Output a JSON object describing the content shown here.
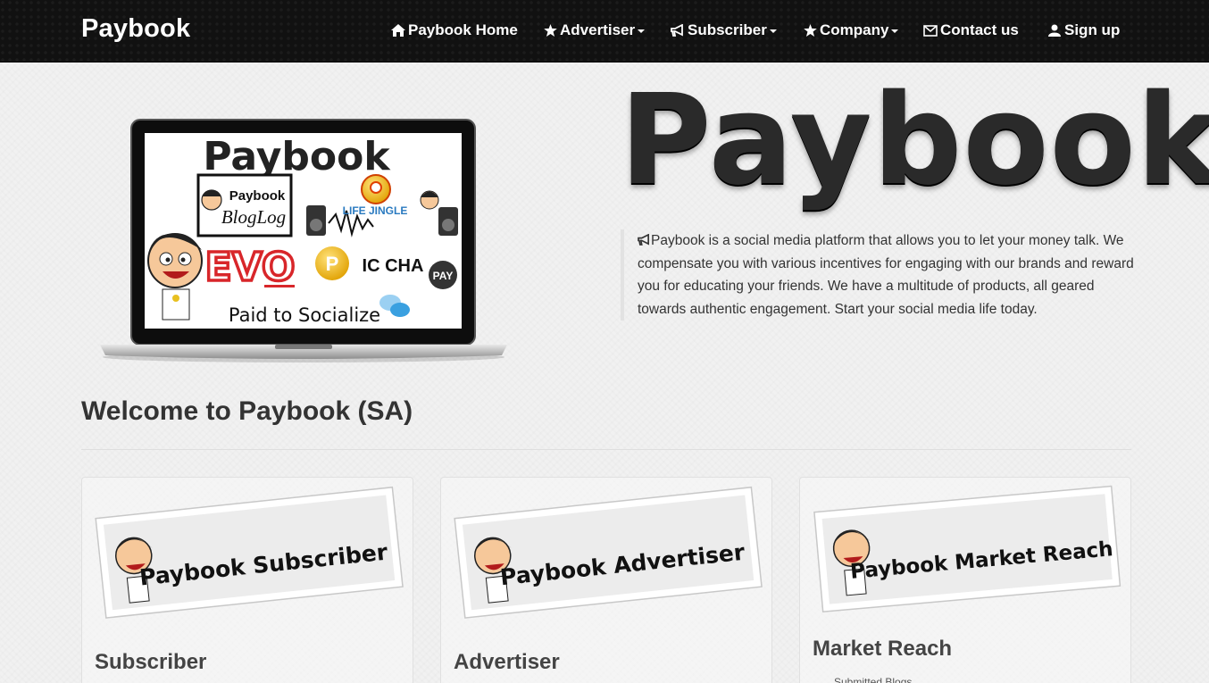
{
  "navbar": {
    "brand": "Paybook",
    "items": [
      {
        "label": "Paybook Home",
        "icon": "home-icon",
        "dropdown": false
      },
      {
        "label": "Advertiser",
        "icon": "star-icon",
        "dropdown": true
      },
      {
        "label": "Subscriber",
        "icon": "bullhorn-icon",
        "dropdown": true
      },
      {
        "label": "Company",
        "icon": "star-icon",
        "dropdown": true
      },
      {
        "label": "Contact us",
        "icon": "envelope-icon",
        "dropdown": false
      },
      {
        "label": "Sign up",
        "icon": "user-icon",
        "dropdown": false
      }
    ]
  },
  "hero": {
    "title": "Paybook",
    "laptop_screen": {
      "title": "Paybook",
      "bloglog_top": "Paybook",
      "bloglog_bottom": "BlogLog",
      "jingle": "LIFE JINGLE",
      "evo": "EVO",
      "picchat": "IC CHA",
      "pay_badge": "PAY",
      "tagline": "Paid to Socialize"
    },
    "intro": "Paybook is a social media platform that allows you to let your money talk. We compensate you with various incentives for engaging with our brands and reward you for educating your friends. We have a multitude of products, all geared towards authentic engagement. Start your social media life today."
  },
  "welcome": "Welcome to Paybook (SA)",
  "cards": [
    {
      "banner": "Paybook Subscriber",
      "title": "Subscriber"
    },
    {
      "banner": "Paybook Advertiser",
      "title": "Advertiser"
    },
    {
      "banner": "Paybook Market Reach",
      "title": "Market Reach",
      "sub": "Submitted Blogs"
    }
  ],
  "colors": {
    "navbar": "#111111",
    "background": "#f1f1f1",
    "text": "#333333"
  }
}
